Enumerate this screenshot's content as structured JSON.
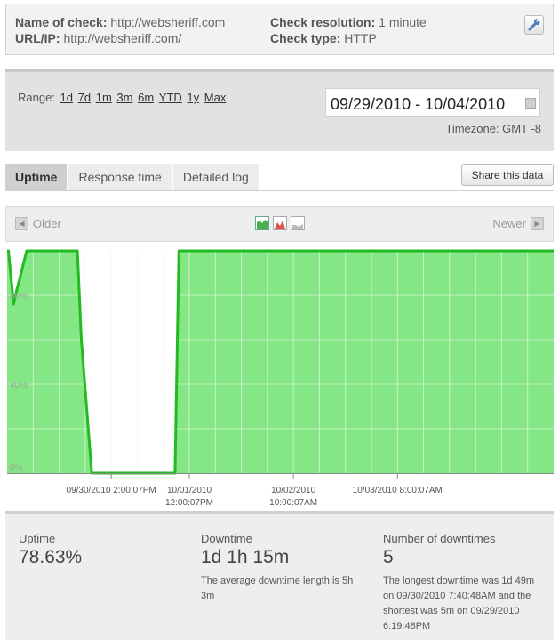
{
  "check": {
    "name_label": "Name of check:",
    "name_value": "http://websheriff.com",
    "url_label": "URL/IP:",
    "url_value": "http://websheriff.com/",
    "resolution_label": "Check resolution:",
    "resolution_value": "1 minute",
    "type_label": "Check type:",
    "type_value": "HTTP",
    "settings_icon": "wrench-icon"
  },
  "range": {
    "label": "Range:",
    "options": [
      "1d",
      "7d",
      "1m",
      "3m",
      "6m",
      "YTD",
      "1y",
      "Max"
    ],
    "date_range": "09/29/2010 - 10/04/2010",
    "calendar_icon": "calendar-icon",
    "timezone": "Timezone: GMT -8"
  },
  "tabs": [
    {
      "label": "Uptime",
      "active": true
    },
    {
      "label": "Response time",
      "active": false
    },
    {
      "label": "Detailed log",
      "active": false
    }
  ],
  "share_label": "Share this data",
  "nav": {
    "older": "Older",
    "newer": "Newer",
    "chart_types": [
      "area-chart-icon",
      "mountain-chart-icon",
      "line-chart-icon"
    ]
  },
  "chart_data": {
    "type": "area",
    "x": [
      0.0,
      0.05,
      0.25,
      0.32,
      0.75,
      0.98,
      2.7,
      2.85,
      3.25,
      3.3,
      3.55,
      6.45,
      6.6,
      21.0
    ],
    "y": [
      100,
      100,
      76,
      80,
      100,
      100,
      100,
      60,
      0,
      0,
      0,
      0,
      100,
      100
    ],
    "x_unit": "hours from left edge of chart",
    "ylim": [
      0,
      100
    ],
    "y_ticks": [
      {
        "value": 0,
        "label": "0%"
      },
      {
        "value": 40,
        "label": "40%"
      },
      {
        "value": 80,
        "label": "80%"
      }
    ],
    "x_ticks": [
      {
        "line1": "09/30/2010 2:00:07PM",
        "line2": ""
      },
      {
        "line1": "10/01/2010",
        "line2": "12:00:07PM"
      },
      {
        "line1": "10/02/2010",
        "line2": "10:00:07AM"
      },
      {
        "line1": "10/03/2010 8:00:07AM",
        "line2": ""
      }
    ],
    "x_tick_positions": [
      4.0,
      7.0,
      11.0,
      15.0
    ],
    "x_max": 21.0,
    "fill_color": "#84e684",
    "line_color": "#22bb22",
    "grid": true
  },
  "stats": {
    "uptime_label": "Uptime",
    "uptime_value": "78.63%",
    "downtime_label": "Downtime",
    "downtime_value": "1d 1h 15m",
    "downtime_note": "The average downtime length is 5h 3m",
    "count_label": "Number of downtimes",
    "count_value": "5",
    "count_note": "The longest downtime was 1d 49m on 09/30/2010 7:40:48AM and the shortest was 5m on 09/29/2010 6:19:48PM"
  }
}
